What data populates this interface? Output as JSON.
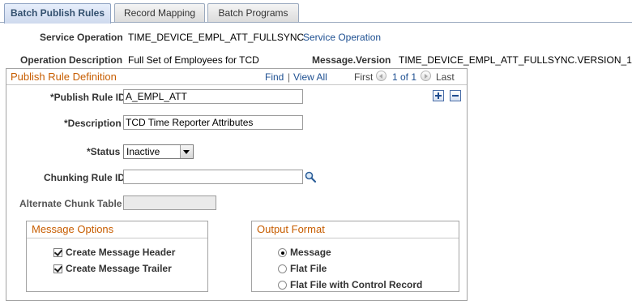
{
  "tabs": [
    {
      "label": "Batch Publish Rules",
      "active": true
    },
    {
      "label": "Record Mapping",
      "active": false
    },
    {
      "label": "Batch Programs",
      "active": false
    }
  ],
  "header": {
    "service_operation_label": "Service Operation",
    "service_operation_value": "TIME_DEVICE_EMPL_ATT_FULLSYNC",
    "service_operation_link": "Service Operation",
    "operation_description_label": "Operation Description",
    "operation_description_value": "Full Set of Employees for TCD",
    "message_version_label": "Message.Version",
    "message_version_value": "TIME_DEVICE_EMPL_ATT_FULLSYNC.VERSION_1"
  },
  "publish_rule": {
    "title": "Publish Rule Definition",
    "nav": {
      "find": "Find",
      "separator": "|",
      "view_all": "View All",
      "first": "First",
      "count": "1 of 1",
      "last": "Last"
    },
    "fields": {
      "rule_id_label": "*Publish Rule ID",
      "rule_id_value": "A_EMPL_ATT",
      "description_label": "*Description",
      "description_value": "TCD Time Reporter Attributes",
      "status_label": "*Status",
      "status_value": "Inactive",
      "chunking_label": "Chunking Rule ID",
      "chunking_value": "",
      "alt_chunk_label": "Alternate Chunk Table",
      "alt_chunk_value": ""
    },
    "message_options": {
      "title": "Message Options",
      "items": [
        {
          "label": "Create Message Header",
          "checked": true
        },
        {
          "label": "Create Message Trailer",
          "checked": true
        }
      ]
    },
    "output_format": {
      "title": "Output Format",
      "options": [
        {
          "label": "Message",
          "selected": true
        },
        {
          "label": "Flat File",
          "selected": false
        },
        {
          "label": "Flat File with Control Record",
          "selected": false
        }
      ]
    }
  },
  "colors": {
    "group_title": "#c75d00",
    "link": "#1d4f91",
    "tab_active_text": "#33506e"
  }
}
